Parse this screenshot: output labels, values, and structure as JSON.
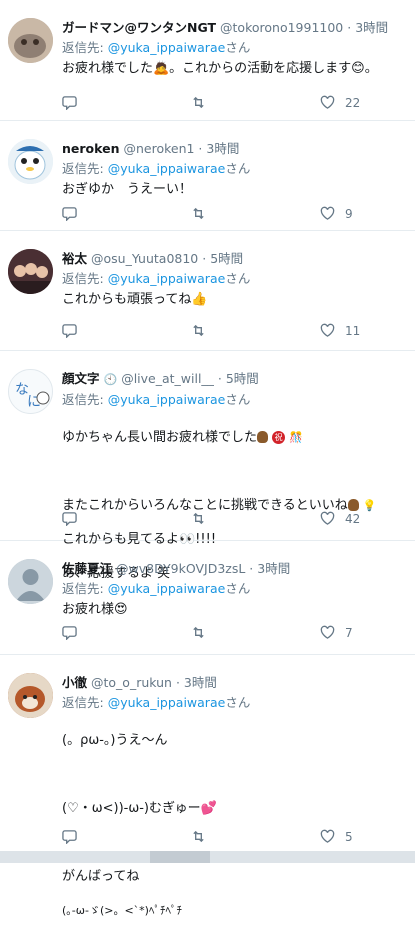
{
  "reply_prefix": "返信先:",
  "reply_target": "@yuka_ippaiwarae",
  "reply_suffix": "さん",
  "tweets": [
    {
      "name": "ガードマン@ワンタンNGT",
      "handle": "@tokorono1991100",
      "time": "3時間",
      "lines": [
        "お疲れ様でした🙇。これからの活動を応援します😊。"
      ],
      "likes": "22",
      "avatar_color": "#b9a89a"
    },
    {
      "name": "neroken",
      "handle": "@neroken1",
      "time": "3時間",
      "lines": [
        "おぎゆか　うえーい！"
      ],
      "likes": "9",
      "avatar_color": "#d8e6f0"
    },
    {
      "name": "裕太",
      "handle": "@osu_Yuuta0810",
      "time": "5時間",
      "lines": [
        "これからも頑張ってね👍"
      ],
      "likes": "11",
      "avatar_color": "#5b3a3a"
    },
    {
      "name": "顔文字",
      "handle": "@live_at_will__",
      "time": "5時間",
      "lines": [
        "ゆかちゃん長い間お疲れ様でした",
        "",
        "またこれからいろんなことに挑戦できるといいね",
        "これからも見てるよ👀!!!!",
        "あ、応援するよ 笑"
      ],
      "likes": "42",
      "avatar_color": "#f2f6f9"
    },
    {
      "name": "佐藤夏江",
      "handle": "@wv8DY9kOVJD3zsL",
      "time": "3時間",
      "lines": [
        "お疲れ様😍"
      ],
      "likes": "7",
      "avatar_color": "#aab8c2"
    },
    {
      "name": "小徹",
      "handle": "@to_o_rukun",
      "time": "3時間",
      "lines": [
        "(。ρω-。)うえ～ん",
        "",
        "(♡・ω<))-ω-)むぎゅー💕",
        "",
        "がんばってね",
        "(｡-ω-ゞ(>。<`*)ﾍﾟﾁﾍﾟﾁ"
      ],
      "likes": "5",
      "avatar_color": "#a85a2e"
    }
  ]
}
